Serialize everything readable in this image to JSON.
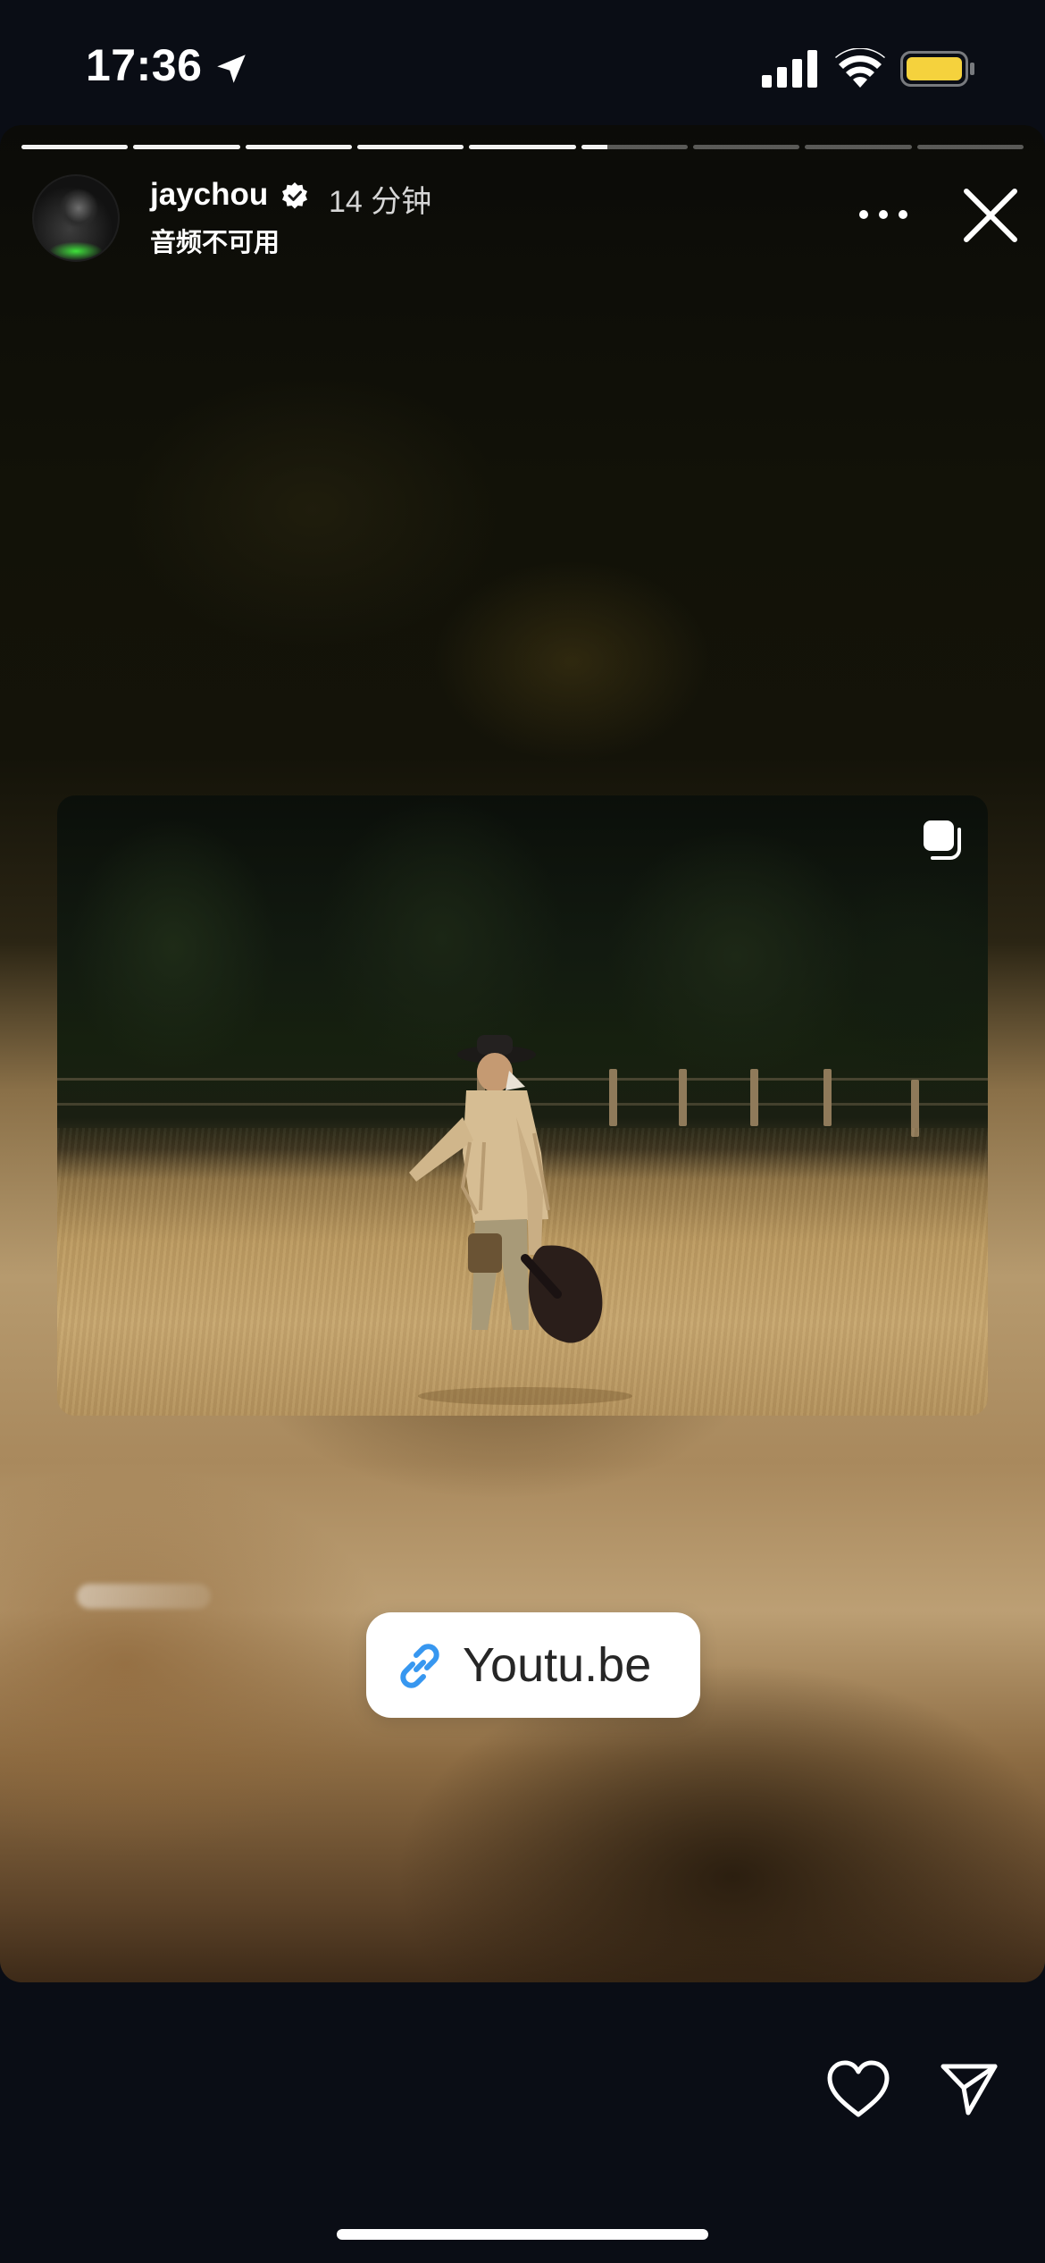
{
  "status_bar": {
    "time": "17:36",
    "icons": [
      "location-arrow-icon",
      "cellular-signal-icon",
      "wifi-icon",
      "battery-icon"
    ],
    "battery_color": "#f5d23d"
  },
  "story": {
    "segments_total": 9,
    "segments_viewed": 5,
    "current_segment_progress": 0.25,
    "username": "jaychou",
    "verified": true,
    "time_ago": "14 分钟",
    "audio_note": "音频不可用",
    "post_media": {
      "type": "multi-photo-post",
      "indicator_icon": "multiple-photos-icon"
    },
    "link_sticker": {
      "icon": "link-icon",
      "label": "Youtu.be",
      "icon_color": "#3797f0"
    }
  },
  "actions": {
    "more": "more-options-icon",
    "close": "close-icon",
    "like": "heart-icon",
    "share": "send-icon"
  },
  "colors": {
    "screen_background": "#0a0d15",
    "progress_active": "#f2f2f2",
    "progress_inactive": "rgba(255,255,255,0.32)"
  }
}
